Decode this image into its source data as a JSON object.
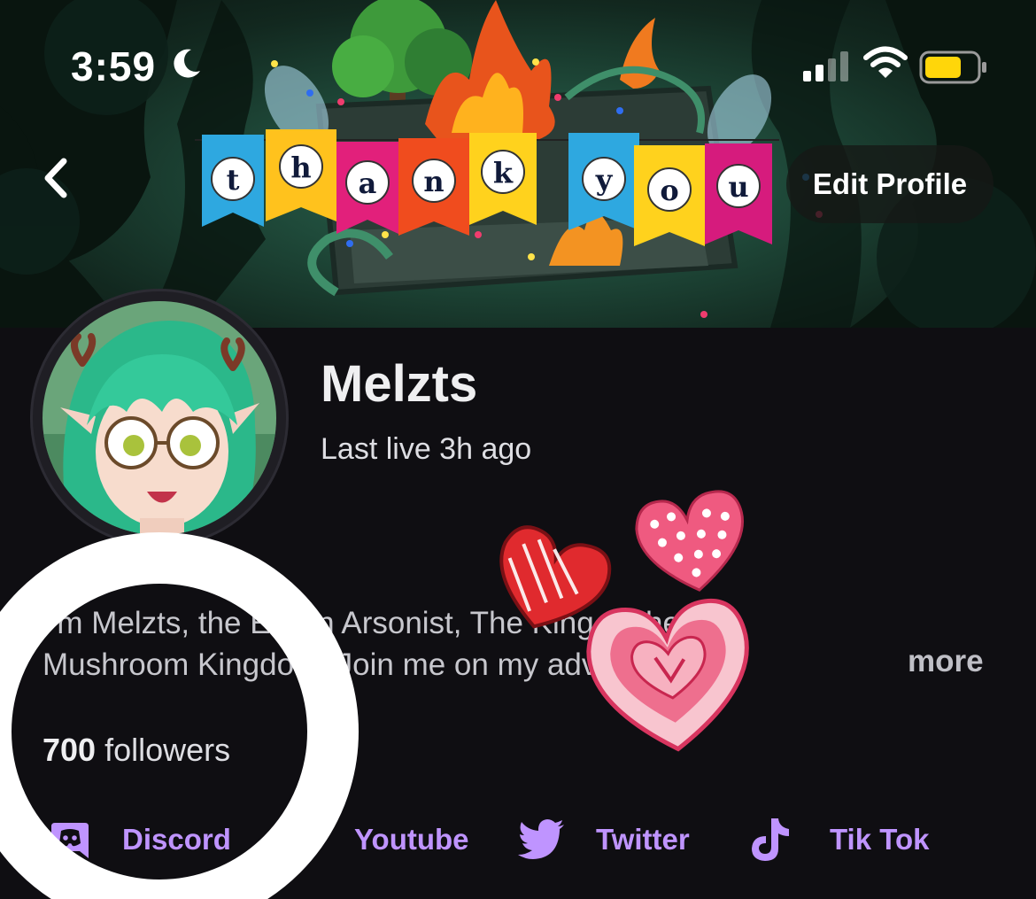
{
  "status_bar": {
    "time": "3:59",
    "moon_icon": "moon-icon",
    "signal_icon": "cellular-signal-icon",
    "wifi_icon": "wifi-icon",
    "battery_icon": "battery-icon",
    "battery_color": "#ffd60a"
  },
  "banner": {
    "letters": [
      "t",
      "h",
      "a",
      "n",
      "k",
      "y",
      "o",
      "u"
    ],
    "back_icon": "chevron-left-icon"
  },
  "header": {
    "edit_profile_label": "Edit Profile"
  },
  "profile": {
    "name": "Melzts",
    "last_live": "Last live 3h ago",
    "bio_line_1": "I'm Melzts, the Elvian Arsonist, The King of the",
    "bio_line_2": "Mushroom Kingdom. Join me on my adventure",
    "more_label": "more",
    "followers_count": "700",
    "followers_label": "followers"
  },
  "social_links": [
    {
      "label": "Discord",
      "icon": "discord-icon"
    },
    {
      "label": "Youtube",
      "icon": "youtube-icon"
    },
    {
      "label": "Twitter",
      "icon": "twitter-icon"
    },
    {
      "label": "Tik Tok",
      "icon": "tiktok-icon"
    }
  ],
  "colors": {
    "accent": "#bf94ff",
    "background": "#0f0e12"
  }
}
